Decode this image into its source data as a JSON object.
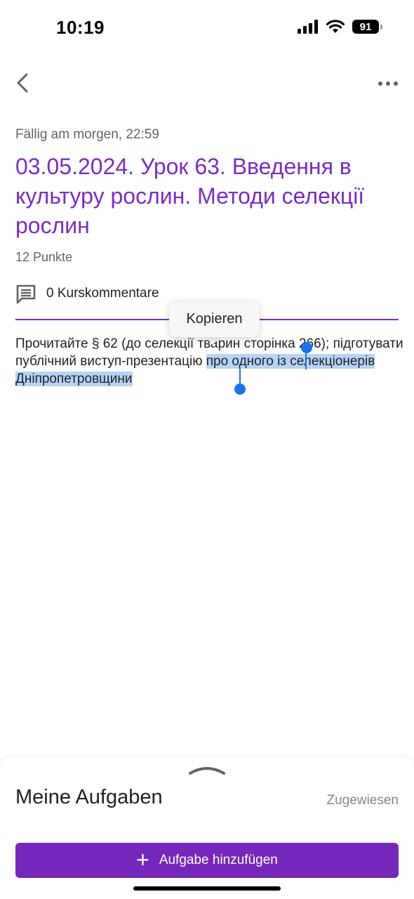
{
  "status_bar": {
    "time": "10:19",
    "battery": "91"
  },
  "assignment": {
    "due": "Fällig am morgen, 22:59",
    "title": "03.05.2024. Урок 63. Введення в культуру рослин. Методи селекції рослин",
    "points": "12 Punkte",
    "comments_label": "0 Kurskommentare",
    "description_plain": "Прочитайте § 62 (до селекції тварин сторінка 266); підготувати публічний виступ-презентацію ",
    "description_selected": "про одного із селекціонерів Дніпропетровщини"
  },
  "context_menu": {
    "copy_label": "Kopieren"
  },
  "bottom_sheet": {
    "title": "Meine Aufgaben",
    "status": "Zugewiesen",
    "add_button_label": "Aufgabe hinzufügen",
    "add_button_icon": "+"
  },
  "colors": {
    "accent": "#7b2cbf",
    "button": "#7627bb",
    "selection": "#b7d3f5",
    "handle": "#1a73e8"
  },
  "icons": [
    "back-arrow-icon",
    "more-icon",
    "comment-icon",
    "signal-icon",
    "wifi-icon",
    "battery-icon",
    "plus-icon",
    "chevron-up-icon"
  ]
}
